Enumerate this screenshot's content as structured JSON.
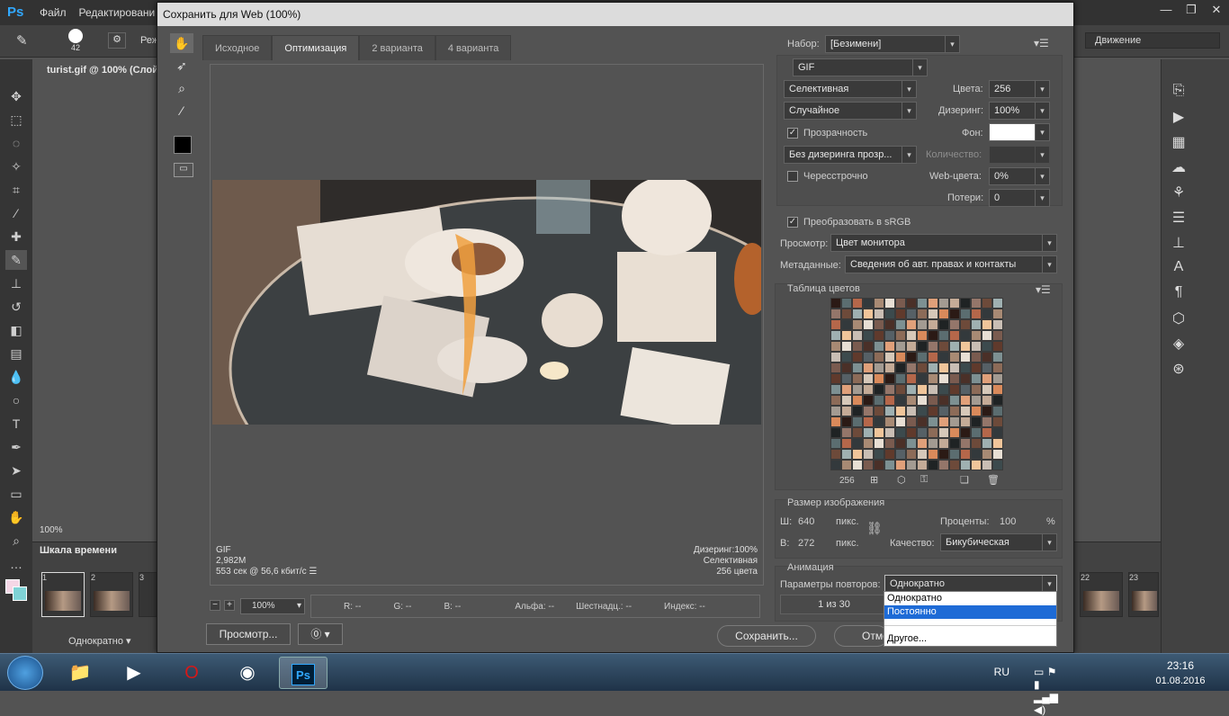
{
  "ps": {
    "logo": "Ps",
    "menu": [
      "Файл",
      "Редактировани"
    ],
    "doc_tab": "turist.gif @ 100% (Слой",
    "brush_size": "42",
    "mode_label": "Реж",
    "motion": "Движение",
    "zoom_status": "100%",
    "timeline_tab": "Шкала времени",
    "frames": [
      "1",
      "2",
      "3",
      "22",
      "23"
    ],
    "loop_bottom": "Однократно",
    "win_controls": [
      "—",
      "❐",
      "✕"
    ]
  },
  "dialog": {
    "title": "Сохранить для Web (100%)",
    "tabs": [
      "Исходное",
      "Оптимизация",
      "2 варианта",
      "4 варианта"
    ],
    "active_tab": 1,
    "info_left": [
      "GIF",
      "2,982M",
      "553 сек @ 56,6 кбит/с"
    ],
    "info_right": [
      "Дизеринг:100%",
      "Селективная",
      "256 цвета"
    ],
    "zoom": "100%",
    "readouts": {
      "r": "R: --",
      "g": "G: --",
      "b": "B: --",
      "alpha": "Альфа: --",
      "hex": "Шестнадц.: --",
      "index": "Индекс: --"
    },
    "preview_btn": "Просмотр...",
    "save_btn": "Сохранить...",
    "cancel_btn": "Отмена"
  },
  "settings": {
    "preset_label": "Набор:",
    "preset_value": "[Безимени]",
    "format": "GIF",
    "reduction": "Селективная",
    "colors_label": "Цвета:",
    "colors_value": "256",
    "dither_algo": "Случайное",
    "dither_label": "Дизеринг:",
    "dither_value": "100%",
    "transparency_label": "Прозрачность",
    "matte_label": "Фон:",
    "trans_dither": "Без дизеринга прозр...",
    "amount_label": "Количество:",
    "interlaced_label": "Чересстрочно",
    "websnap_label": "Web-цвета:",
    "websnap_value": "0%",
    "lossy_label": "Потери:",
    "lossy_value": "0",
    "convert_srgb": "Преобразовать в sRGB",
    "preview_label": "Просмотр:",
    "preview_value": "Цвет монитора",
    "metadata_label": "Метаданные:",
    "metadata_value": "Сведения об авт. правах и контакты",
    "color_table_label": "Таблица цветов",
    "color_count": "256",
    "image_size_label": "Размер изображения",
    "w_label": "Ш:",
    "w_value": "640",
    "h_label": "В:",
    "h_value": "272",
    "px": "пикс.",
    "percent_label": "Проценты:",
    "percent_value": "100",
    "percent_sign": "%",
    "quality_label": "Качество:",
    "quality_value": "Бикубическая",
    "animation_label": "Анимация",
    "loop_label": "Параметры повторов:",
    "loop_value": "Однократно",
    "frame_counter": "1 из 30",
    "loop_options": [
      "Однократно",
      "Постоянно",
      "Другое..."
    ],
    "loop_highlight": 1
  },
  "taskbar": {
    "lang": "RU",
    "time": "23:16",
    "date": "01.08.2016"
  },
  "colors": {
    "accent_ps": "#31a8ff",
    "highlight": "#1e6bd6"
  },
  "palette": [
    "#2b1a15",
    "#4a3028",
    "#6d4a3a",
    "#8c6b58",
    "#a88a74",
    "#c4ab97",
    "#3c4a4d",
    "#5b6d70",
    "#7d9092",
    "#9fb0b1",
    "#d6c8b9",
    "#e8dfd4",
    "#1f2324",
    "#603a2c",
    "#b5674a",
    "#e0a07a",
    "#f0c59a",
    "#d98a5b",
    "#7a5b4f",
    "#94766a",
    "#566066",
    "#33393c",
    "#a39b92",
    "#c9beb4"
  ]
}
